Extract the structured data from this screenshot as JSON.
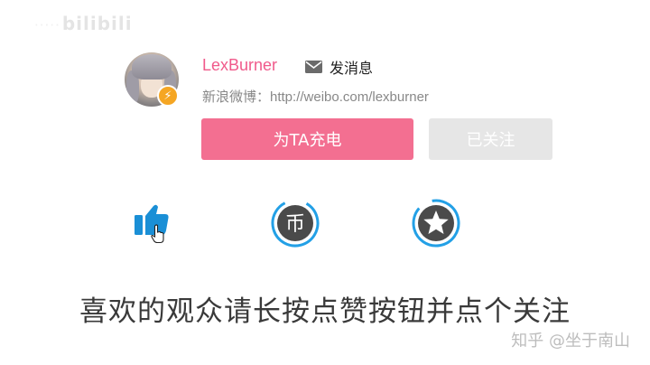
{
  "watermark": {
    "text": "bilibili",
    "prefix": "·····"
  },
  "user": {
    "name": "LexBurner",
    "weibo": "新浪微博：http://weibo.com/lexburner"
  },
  "actions": {
    "message_label": "发消息",
    "charge_label": "为TA充电",
    "follow_label": "已关注"
  },
  "icons": [
    "envelope-icon",
    "lightning-badge-icon",
    "thumbs-up-icon",
    "cursor-hand-icon",
    "coin-icon",
    "star-icon"
  ],
  "colors": {
    "accent_pink": "#f05a8b",
    "charge_button": "#f36f91",
    "follow_button": "#e6e6e6",
    "like_blue": "#1a8fd6",
    "ring_blue": "#23a0e6",
    "icon_gray": "#4a4a4a",
    "badge_orange": "#f5a623"
  },
  "subtitle": "喜欢的观众请长按点赞按钮并点个关注",
  "source_watermark": "知乎 @坐于南山"
}
